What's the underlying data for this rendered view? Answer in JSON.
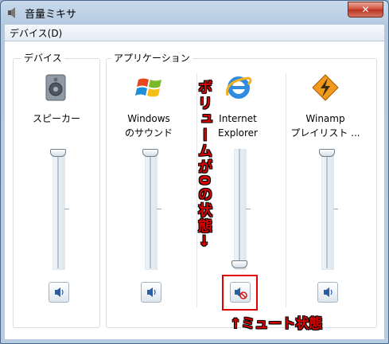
{
  "window": {
    "title": "音量ミキサ",
    "close_glyph": "✕"
  },
  "menu": {
    "items": [
      "デバイス(D)"
    ]
  },
  "groups": {
    "devices_label": "デバイス",
    "apps_label": "アプリケーション"
  },
  "columns": [
    {
      "id": "speaker",
      "label": "スピーカー",
      "icon": "speaker-icon",
      "volume_level": 1.0,
      "muted": false
    },
    {
      "id": "windows-sound",
      "label": "Windows\nのサウンド",
      "icon": "windows-logo-icon",
      "volume_level": 1.0,
      "muted": false
    },
    {
      "id": "ie",
      "label": "Internet\nExplorer",
      "icon": "internet-explorer-icon",
      "volume_level": 0.0,
      "muted": true
    },
    {
      "id": "winamp",
      "label": "Winamp\nプレイリスト ...",
      "icon": "winamp-icon",
      "volume_level": 1.0,
      "muted": false
    }
  ],
  "annotations": {
    "vertical_note": "ボリュームが0の状態→",
    "bottom_note": "↑ミュート状態"
  },
  "colors": {
    "annotation": "#e00000",
    "titlebar": "#b4c9e0"
  }
}
